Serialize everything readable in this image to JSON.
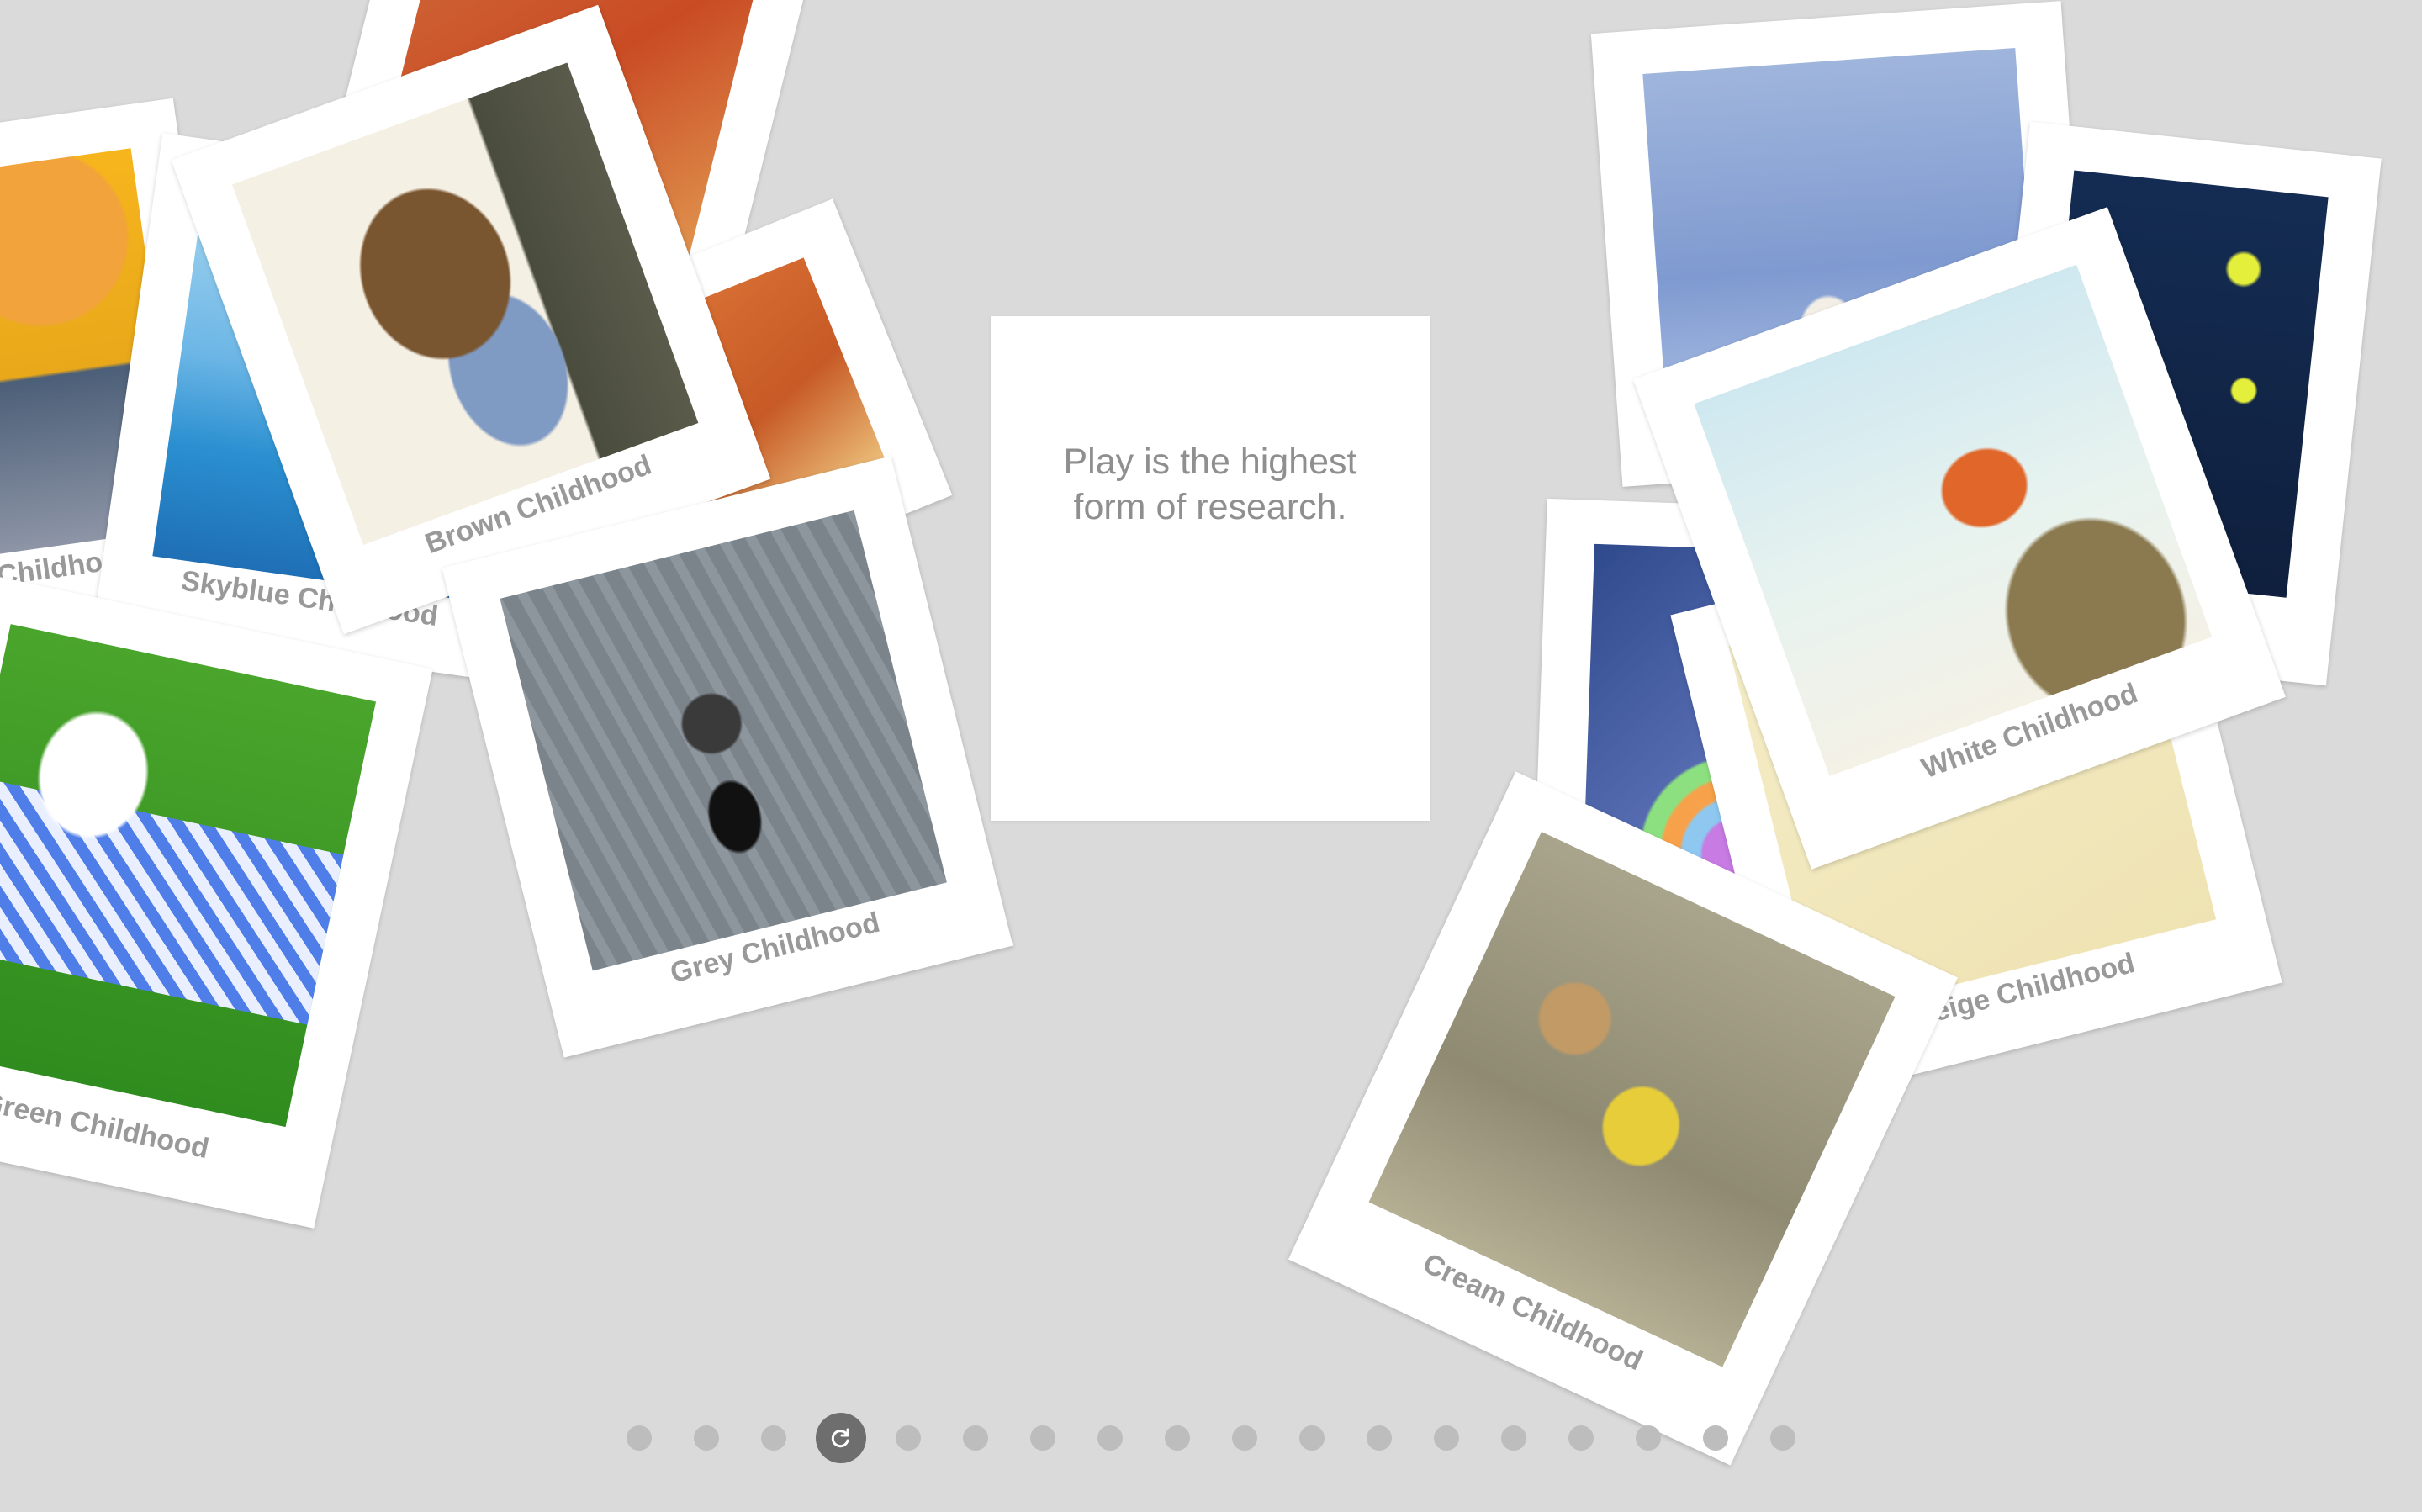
{
  "quote": "Play is the highest form of research.",
  "photos": [
    {
      "id": "orange",
      "caption": ""
    },
    {
      "id": "yellow",
      "caption": "Yellow Childhood"
    },
    {
      "id": "skyblue",
      "caption": "Skyblue Childhood"
    },
    {
      "id": "brown",
      "caption": "Brown Childhood"
    },
    {
      "id": "green",
      "caption": "Green Childhood"
    },
    {
      "id": "grey",
      "caption": "Grey Childhood"
    },
    {
      "id": "blue",
      "caption": ""
    },
    {
      "id": "navy",
      "caption": ""
    },
    {
      "id": "purple",
      "caption": ""
    },
    {
      "id": "white",
      "caption": "White Childhood"
    },
    {
      "id": "beige",
      "caption": "Beige Childhood"
    },
    {
      "id": "cream",
      "caption": "Cream Childhood"
    }
  ],
  "pager": {
    "count": 18,
    "active_index": 3,
    "active_icon": "reload-icon"
  },
  "colors": {
    "background": "#dadada",
    "dot": "#bdbdbd",
    "dot_active": "#6e6e6e",
    "caption": "#999999",
    "quote": "#8f8f8f"
  }
}
